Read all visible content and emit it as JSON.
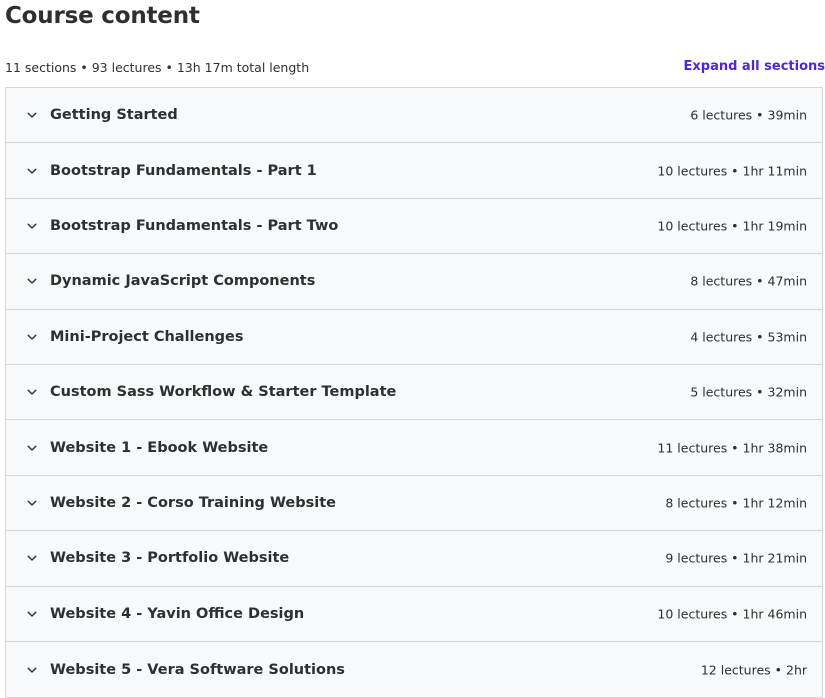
{
  "header": {
    "title": "Course content",
    "summary": "11 sections • 93 lectures • 13h 17m total length",
    "expand_label": "Expand all sections"
  },
  "colors": {
    "accent": "#5624d0",
    "section_bg": "#f7f9fa",
    "border": "#d1d7dc",
    "text": "#2d2f31"
  },
  "sections": [
    {
      "title": "Getting Started",
      "meta": "6 lectures • 39min"
    },
    {
      "title": "Bootstrap Fundamentals - Part 1",
      "meta": "10 lectures • 1hr 11min"
    },
    {
      "title": "Bootstrap Fundamentals - Part Two",
      "meta": "10 lectures • 1hr 19min"
    },
    {
      "title": "Dynamic JavaScript Components",
      "meta": "8 lectures • 47min"
    },
    {
      "title": "Mini-Project Challenges",
      "meta": "4 lectures • 53min"
    },
    {
      "title": "Custom Sass Workflow & Starter Template",
      "meta": "5 lectures • 32min"
    },
    {
      "title": "Website 1 - Ebook Website",
      "meta": "11 lectures • 1hr 38min"
    },
    {
      "title": "Website 2 - Corso Training Website",
      "meta": "8 lectures • 1hr 12min"
    },
    {
      "title": "Website 3 - Portfolio Website",
      "meta": "9 lectures • 1hr 21min"
    },
    {
      "title": "Website 4 - Yavin Office Design",
      "meta": "10 lectures • 1hr 46min"
    },
    {
      "title": "Website 5 - Vera Software Solutions",
      "meta": "12 lectures • 2hr"
    }
  ]
}
